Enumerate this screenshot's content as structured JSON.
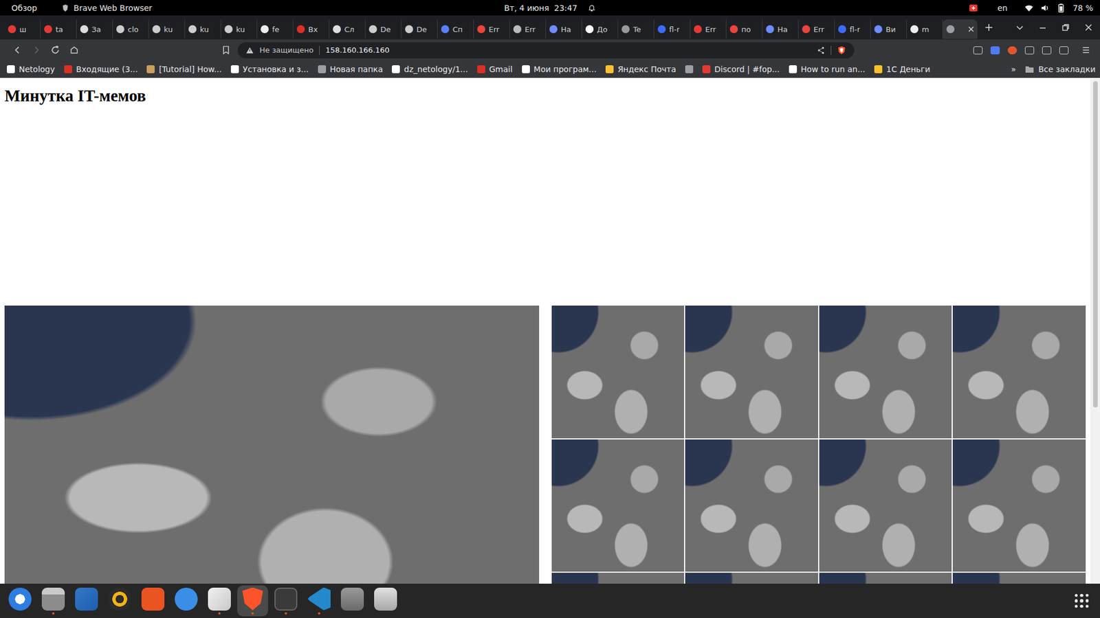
{
  "topbar": {
    "activities": "Обзор",
    "app": "Brave Web Browser",
    "clock": "Вт, 4 июня  23:47",
    "language": "en",
    "battery": "78 %"
  },
  "tabs": [
    {
      "label": "ш",
      "selected": false,
      "color": "#e53935"
    },
    {
      "label": "ta",
      "selected": false,
      "color": "#e53935"
    },
    {
      "label": "За",
      "selected": false,
      "color": "#dddddd"
    },
    {
      "label": "clo",
      "selected": false,
      "color": "#cccccc"
    },
    {
      "label": "ku",
      "selected": false,
      "color": "#cccccc"
    },
    {
      "label": "ku",
      "selected": false,
      "color": "#cccccc"
    },
    {
      "label": "ku",
      "selected": false,
      "color": "#cccccc"
    },
    {
      "label": "fe",
      "selected": false,
      "color": "#eeeeee"
    },
    {
      "label": "Вх",
      "selected": false,
      "color": "#d93025"
    },
    {
      "label": "Сл",
      "selected": false,
      "color": "#dddddd"
    },
    {
      "label": "De",
      "selected": false,
      "color": "#cccccc"
    },
    {
      "label": "De",
      "selected": false,
      "color": "#cccccc"
    },
    {
      "label": "Сп",
      "selected": false,
      "color": "#5b7fff"
    },
    {
      "label": "Err",
      "selected": false,
      "color": "#e8453c"
    },
    {
      "label": "Err",
      "selected": false,
      "color": "#bbbbbb"
    },
    {
      "label": "На",
      "selected": false,
      "color": "#6d8cff"
    },
    {
      "label": "До",
      "selected": false,
      "color": "#ffffff"
    },
    {
      "label": "Te",
      "selected": false,
      "color": "#999999"
    },
    {
      "label": "fl-r",
      "selected": false,
      "color": "#3d6bff"
    },
    {
      "label": "Err",
      "selected": false,
      "color": "#e53935"
    },
    {
      "label": "по",
      "selected": false,
      "color": "#e8453c"
    },
    {
      "label": "На",
      "selected": false,
      "color": "#6d8cff"
    },
    {
      "label": "Err",
      "selected": false,
      "color": "#e8453c"
    },
    {
      "label": "fl-r",
      "selected": false,
      "color": "#3d6bff"
    },
    {
      "label": "Ви",
      "selected": false,
      "color": "#6d8cff"
    },
    {
      "label": "m",
      "selected": false,
      "color": "#eeeeee"
    },
    {
      "label": "",
      "selected": true,
      "color": "#9aa0a6"
    }
  ],
  "address": {
    "security": "Не защищено",
    "url": "158.160.166.160"
  },
  "bookmarks": [
    {
      "label": "Netology",
      "color": "#ffffff"
    },
    {
      "label": "Входящие (3...",
      "color": "#d93025"
    },
    {
      "label": "[Tutorial] How...",
      "color": "#c8a060"
    },
    {
      "label": "Установка и з...",
      "color": "#ffffff"
    },
    {
      "label": "Новая папка",
      "color": "#9aa0a6"
    },
    {
      "label": "dz_netology/1...",
      "color": "#ffffff"
    },
    {
      "label": "Gmail",
      "color": "#d93025"
    },
    {
      "label": "Мои програм...",
      "color": "#ffffff"
    },
    {
      "label": "Яндекс Почта",
      "color": "#fbc02d"
    },
    {
      "label": "",
      "color": "#9aa0a6"
    },
    {
      "label": "Discord | #fop...",
      "color": "#e53935"
    },
    {
      "label": "How to run an...",
      "color": "#ffffff"
    },
    {
      "label": "1С Деньги",
      "color": "#fbc02d"
    }
  ],
  "bookmarks_more": "»",
  "all_bookmarks": "Все закладки",
  "page": {
    "heading": "Минутка IT-мемов",
    "columns": [
      {
        "kind": "single",
        "tiles": 1
      },
      {
        "kind": "grid",
        "tiles": 12
      }
    ]
  },
  "dock": [
    {
      "kind": "mail",
      "running": false,
      "selected": false
    },
    {
      "kind": "files",
      "running": true,
      "selected": false
    },
    {
      "kind": "writer",
      "running": false,
      "selected": false
    },
    {
      "kind": "music",
      "running": false,
      "selected": false
    },
    {
      "kind": "store",
      "running": false,
      "selected": false
    },
    {
      "kind": "help",
      "running": false,
      "selected": false
    },
    {
      "kind": "editor",
      "running": true,
      "selected": false
    },
    {
      "kind": "browser",
      "running": true,
      "selected": true
    },
    {
      "kind": "terminal",
      "running": true,
      "selected": false
    },
    {
      "kind": "code",
      "running": true,
      "selected": false
    },
    {
      "kind": "drive",
      "running": false,
      "selected": false
    },
    {
      "kind": "trash",
      "running": false,
      "selected": false
    }
  ]
}
